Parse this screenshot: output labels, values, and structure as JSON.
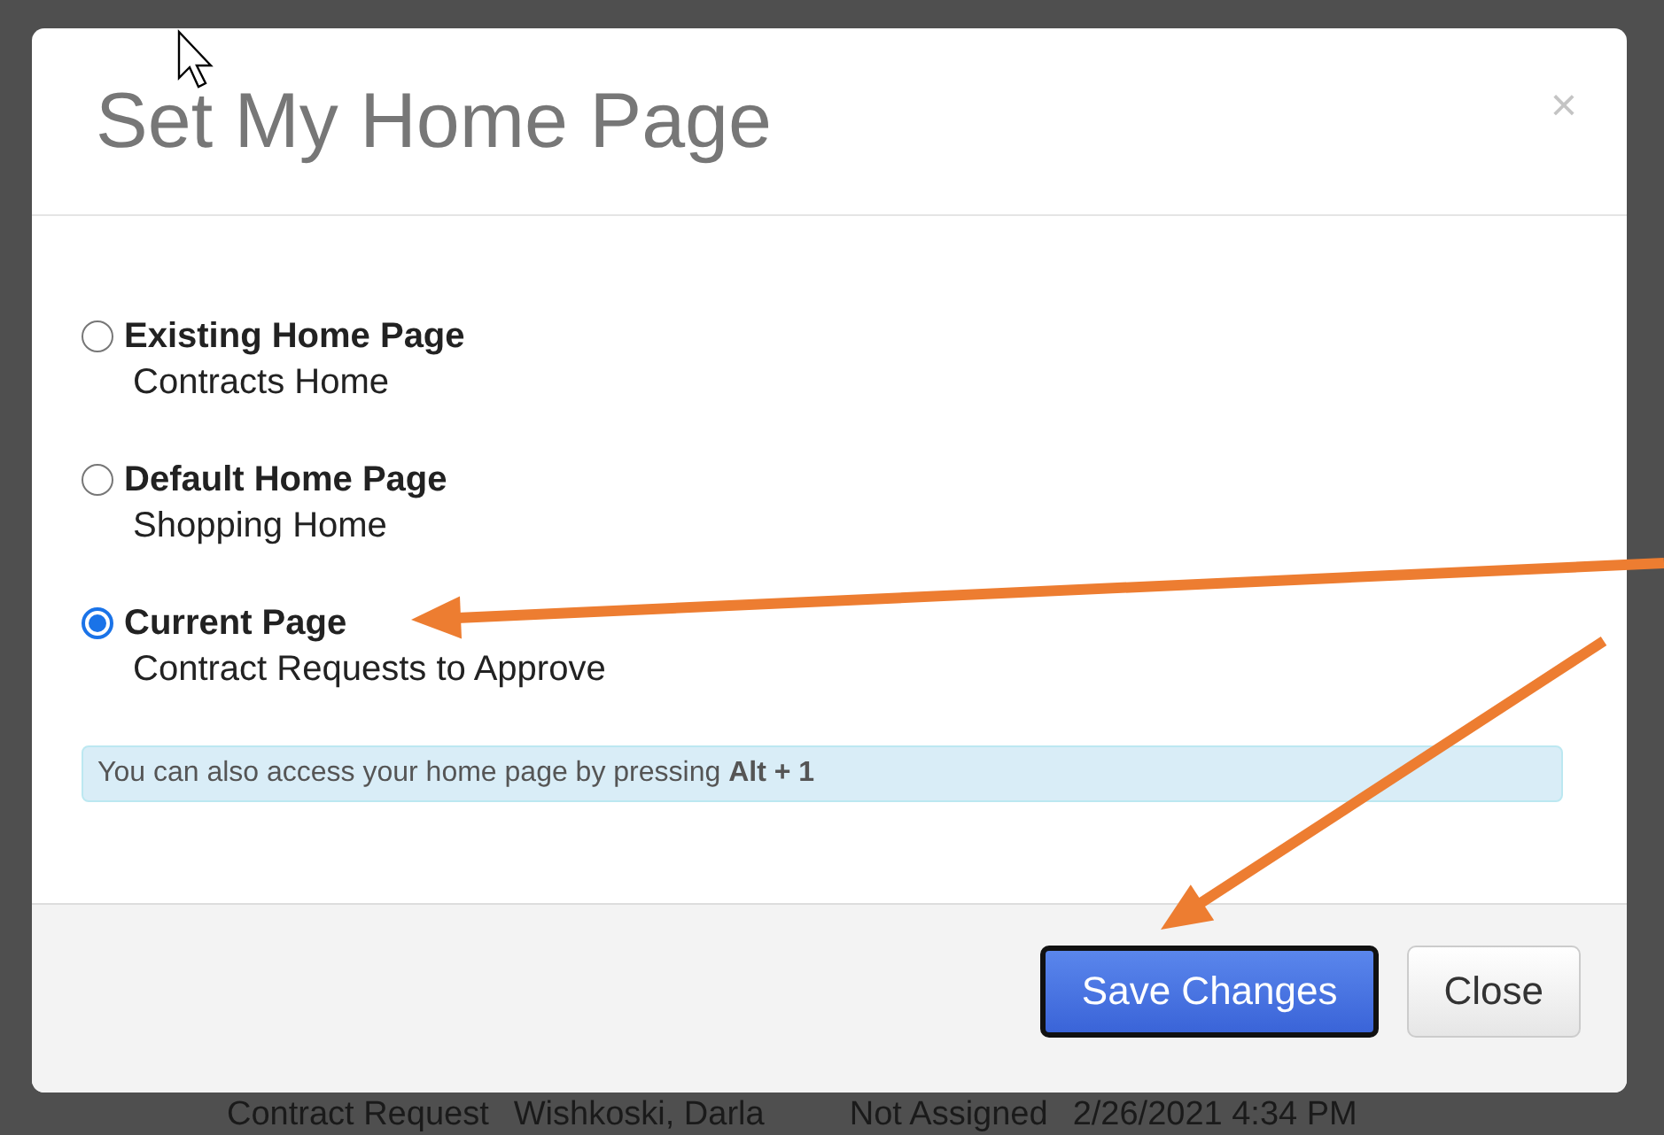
{
  "dialog": {
    "title": "Set My Home Page",
    "close_label": "×",
    "options": [
      {
        "label": "Existing Home Page",
        "description": "Contracts Home",
        "selected": false
      },
      {
        "label": "Default Home Page",
        "description": "Shopping Home",
        "selected": false
      },
      {
        "label": "Current Page",
        "description": "Contract Requests to Approve",
        "selected": true
      }
    ],
    "hint": "You can also access your home page by pressing **Alt + 1**",
    "buttons": [
      {
        "label": "Save Changes",
        "kind": "primary"
      },
      {
        "label": "Close",
        "kind": "default"
      }
    ]
  },
  "background_row": [
    "Contract Request",
    "Wishkoski, Darla",
    "Not Assigned",
    "2/26/2021 4:34 PM"
  ]
}
